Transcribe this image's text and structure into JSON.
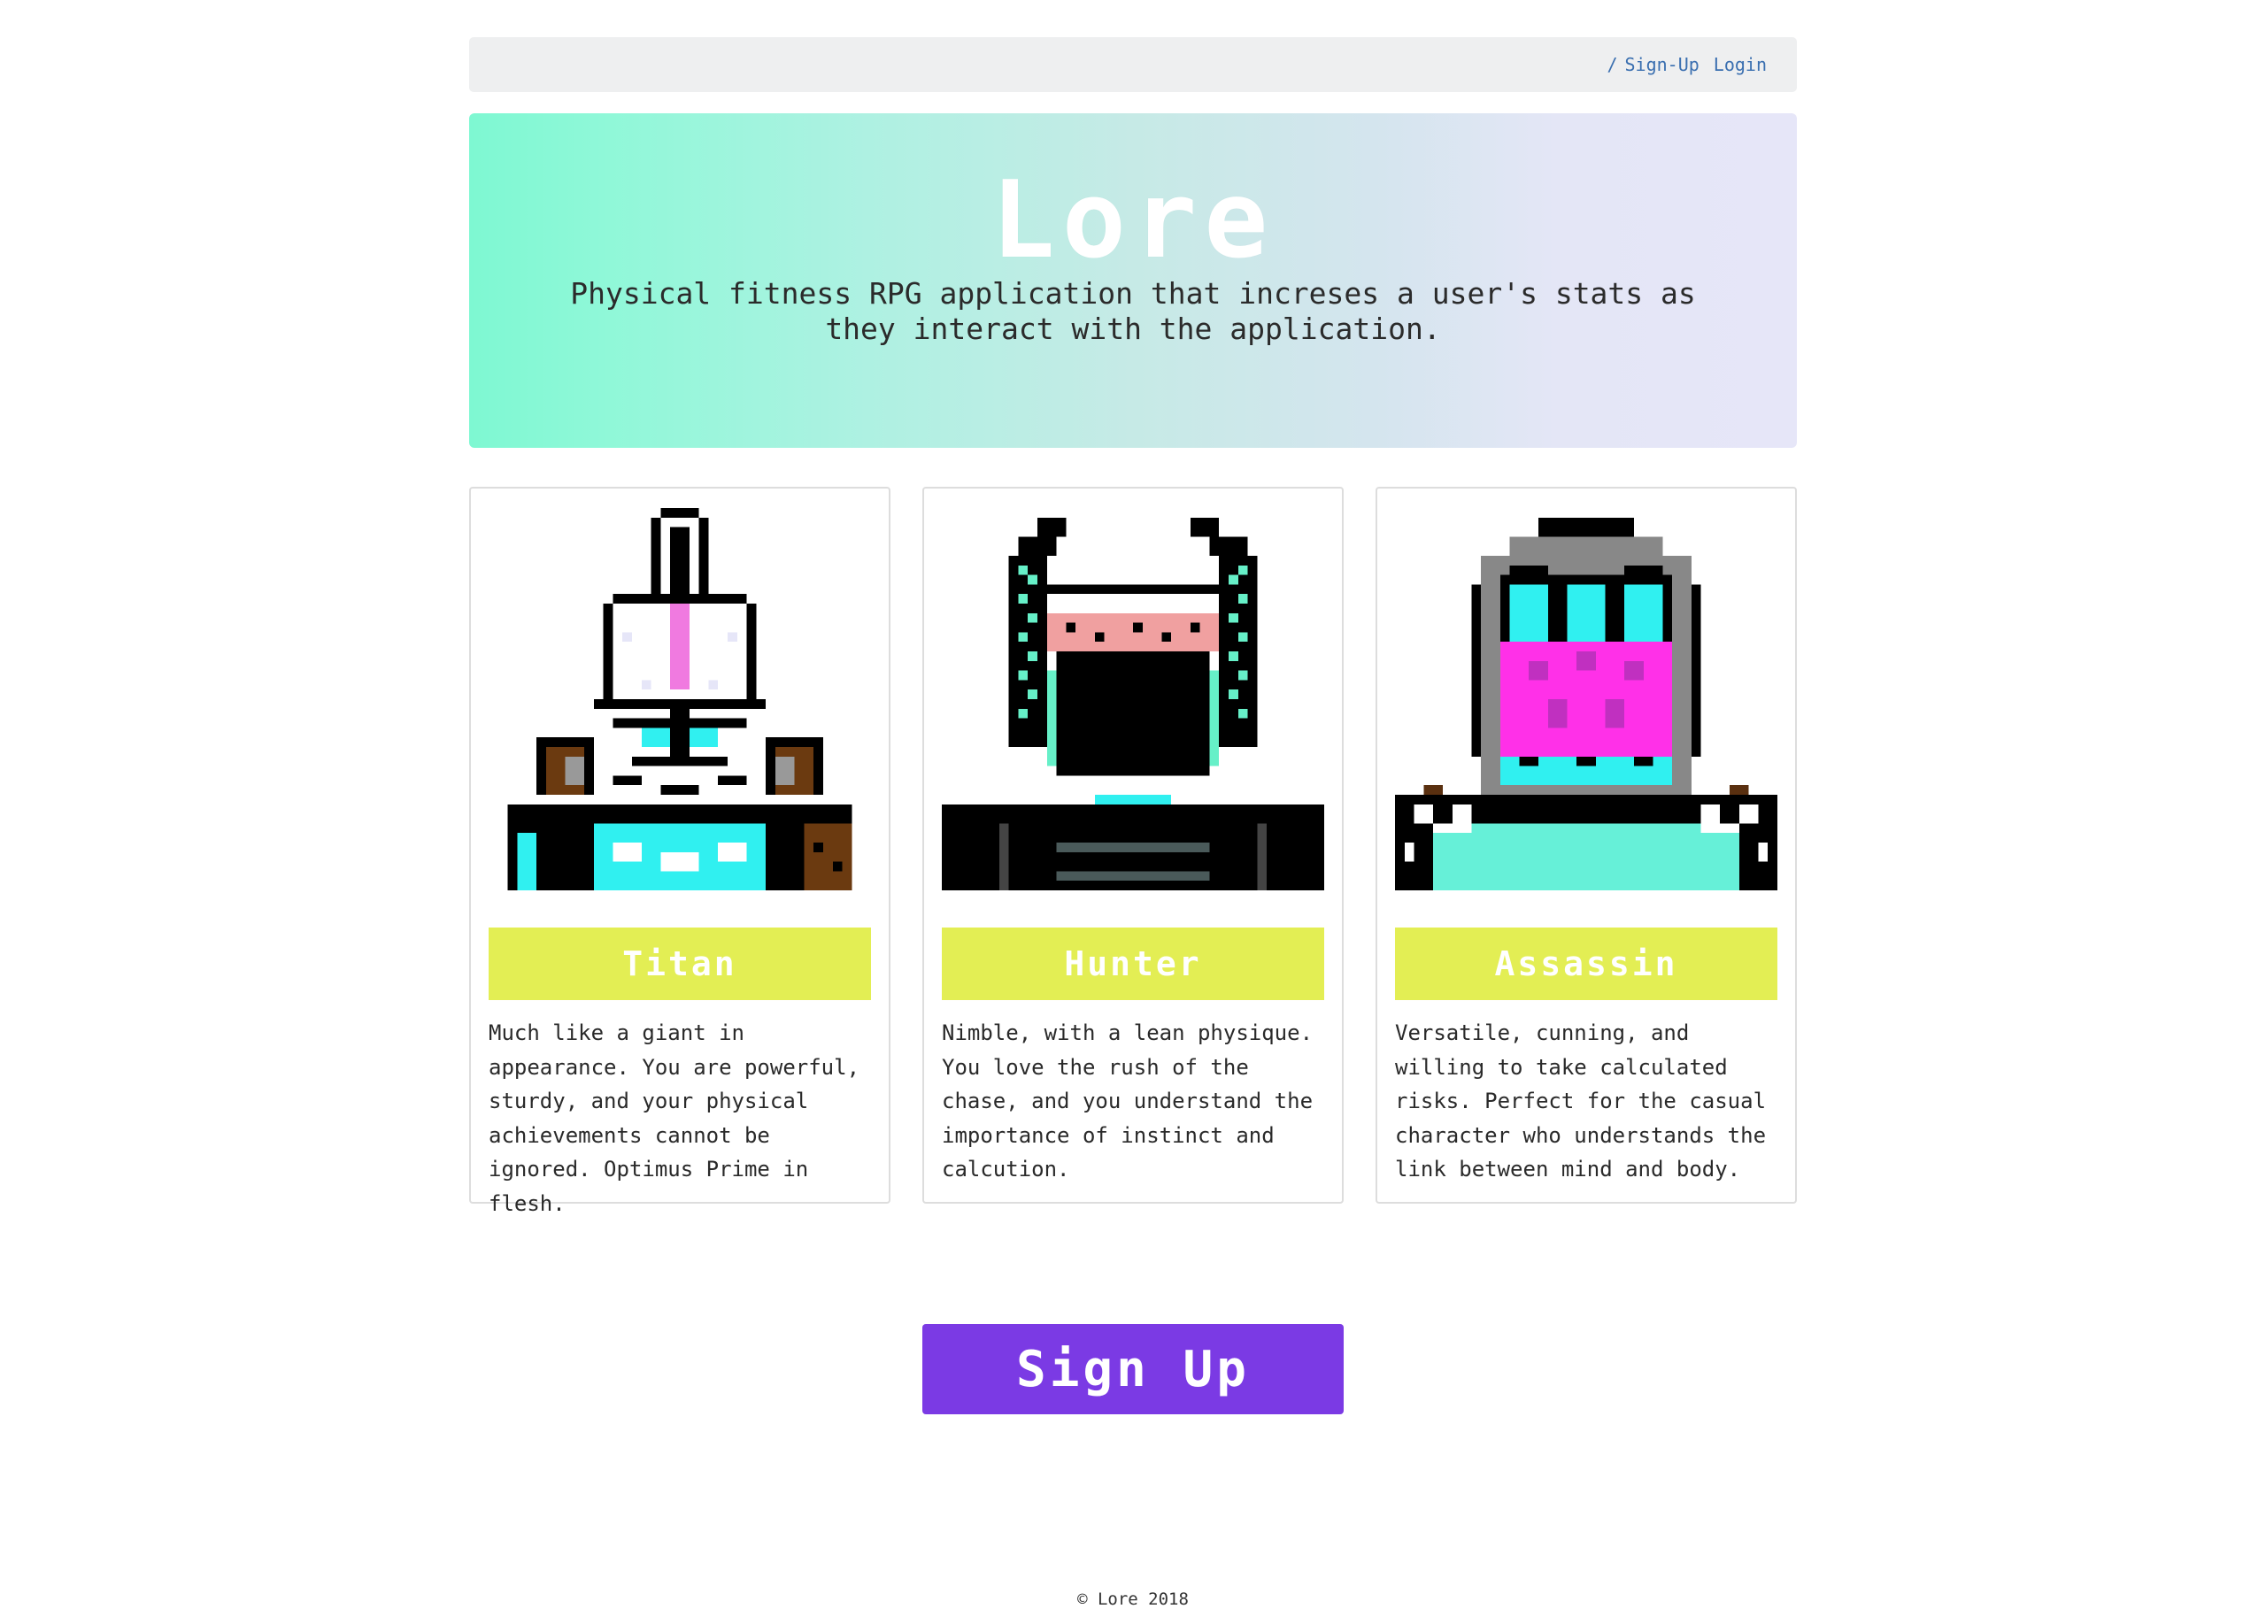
{
  "nav": {
    "separator": "/",
    "signup_label": "Sign-Up",
    "login_label": "Login"
  },
  "hero": {
    "title": "Lore",
    "subtitle": "Physical fitness RPG application that increses a user's stats as they interact with the application."
  },
  "classes": [
    {
      "name": "Titan",
      "icon": "titan-avatar",
      "description": "Much like a giant in appearance. You are powerful, sturdy, and your physical achievements cannot be ignored. Optimus Prime in flesh."
    },
    {
      "name": "Hunter",
      "icon": "hunter-avatar",
      "description": "Nimble, with a lean physique. You love the rush of the chase, and you understand the importance of instinct and calcution."
    },
    {
      "name": "Assassin",
      "icon": "assassin-avatar",
      "description": "Versatile, cunning, and willing to take calculated risks. Perfect for the casual character who understands the link between mind and body."
    }
  ],
  "cta": {
    "label": "Sign Up"
  },
  "footer": {
    "text": "© Lore 2018"
  },
  "colors": {
    "banner": "#e3ee54",
    "cta": "#7b3ae4",
    "link": "#3a6fb0"
  }
}
